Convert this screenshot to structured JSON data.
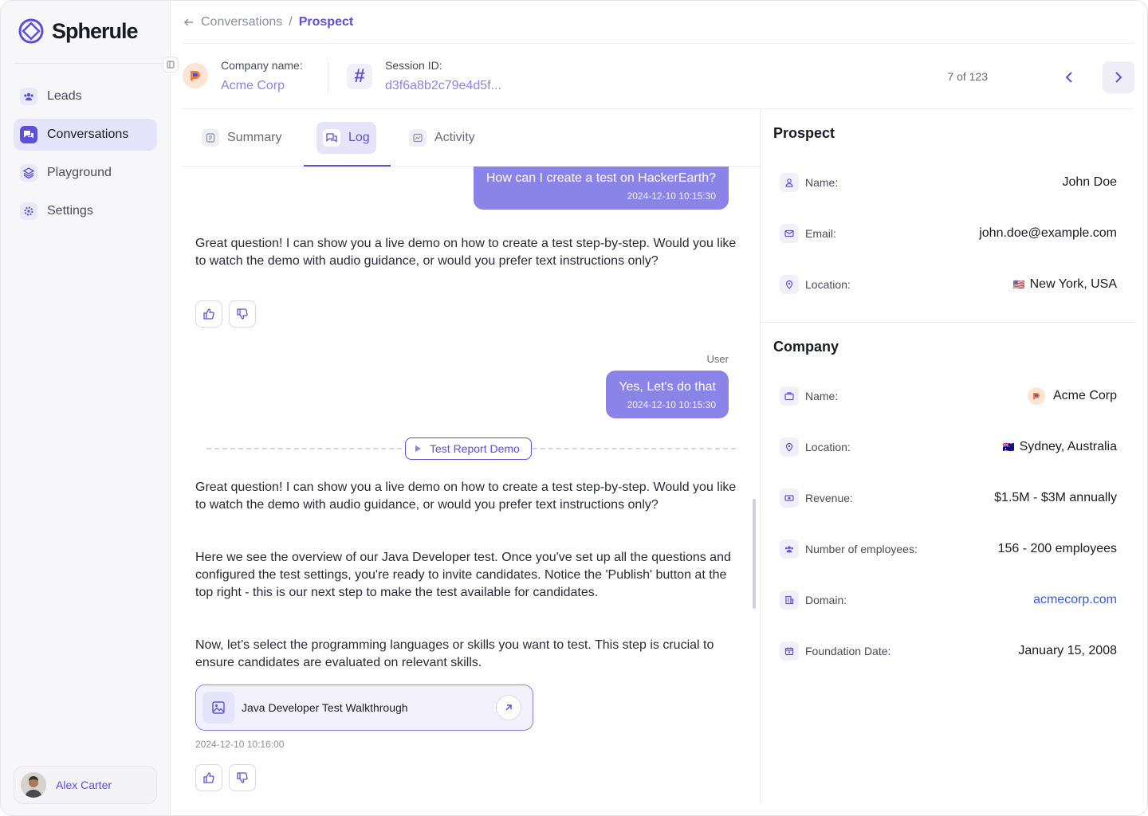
{
  "app": {
    "name": "Spherule"
  },
  "sidebar": {
    "items": [
      {
        "label": "Leads",
        "icon": "users-icon"
      },
      {
        "label": "Conversations",
        "icon": "chat-icon",
        "active": true
      },
      {
        "label": "Playground",
        "icon": "layers-icon"
      },
      {
        "label": "Settings",
        "icon": "gear-icon"
      }
    ],
    "user": {
      "name": "Alex Carter"
    }
  },
  "breadcrumb": {
    "parent": "Conversations",
    "separator": "/",
    "current": "Prospect"
  },
  "session": {
    "company_label": "Company name:",
    "company_value": "Acme Corp",
    "session_label": "Session ID:",
    "session_value": "d3f6a8b2c79e4d5f...",
    "pager": "7 of 123"
  },
  "tabs": [
    {
      "label": "Summary",
      "icon": "document-icon"
    },
    {
      "label": "Log",
      "icon": "chat-icon",
      "active": true
    },
    {
      "label": "Activity",
      "icon": "activity-icon"
    }
  ],
  "log": {
    "msg1": {
      "text": "How can I create a test on HackerEarth?",
      "time": "2024-12-10 10:15:30"
    },
    "bot1": "Great question! I can show you a live demo on how to create a test step-by-step. Would you like to watch the demo with audio guidance, or would you prefer text instructions only?",
    "user_tag": "User",
    "msg2": {
      "text": "Yes, Let's do that",
      "time": "2024-12-10 10:15:30"
    },
    "demo_label": "Test Report Demo",
    "bot2": [
      "Great question! I can show you a live demo on how to create a test step-by-step. Would you like to watch the demo with audio guidance, or would you prefer text instructions only?",
      "Here we see the overview of our Java Developer test. Once you've set up all the questions and configured the test settings, you're ready to invite candidates. Notice the 'Publish' button at the top right - this is our next step to make the test available for candidates.",
      "Now, let’s select the programming languages or skills you want to test. This step is crucial to ensure candidates are evaluated on relevant skills."
    ],
    "walkthrough": {
      "title": "Java Developer Test Walkthrough",
      "time": "2024-12-10 10:16:00"
    }
  },
  "prospect": {
    "title": "Prospect",
    "rows": [
      {
        "label": "Name:",
        "value": "John Doe",
        "icon": "user-icon"
      },
      {
        "label": "Email:",
        "value": "john.doe@example.com",
        "icon": "mail-icon"
      },
      {
        "label": "Location:",
        "value": "New York, USA",
        "icon": "location-icon",
        "flag": "🇺🇸"
      }
    ]
  },
  "company": {
    "title": "Company",
    "rows": [
      {
        "label": "Name:",
        "value": "Acme Corp",
        "icon": "briefcase-icon"
      },
      {
        "label": "Location:",
        "value": "Sydney, Australia",
        "icon": "location-icon",
        "flag": "🇦🇺"
      },
      {
        "label": "Revenue:",
        "value": "$1.5M - $3M annually",
        "icon": "money-icon"
      },
      {
        "label": "Number of employees:",
        "value": "156 - 200 employees",
        "icon": "team-icon"
      },
      {
        "label": "Domain:",
        "value": "acmecorp.com",
        "icon": "building-icon"
      },
      {
        "label": "Foundation Date:",
        "value": "January 15, 2008",
        "icon": "calendar-icon"
      }
    ]
  },
  "colors": {
    "accent": "#5b50d6",
    "bubble": "#8b84e8",
    "link": "#3a5bd6"
  }
}
